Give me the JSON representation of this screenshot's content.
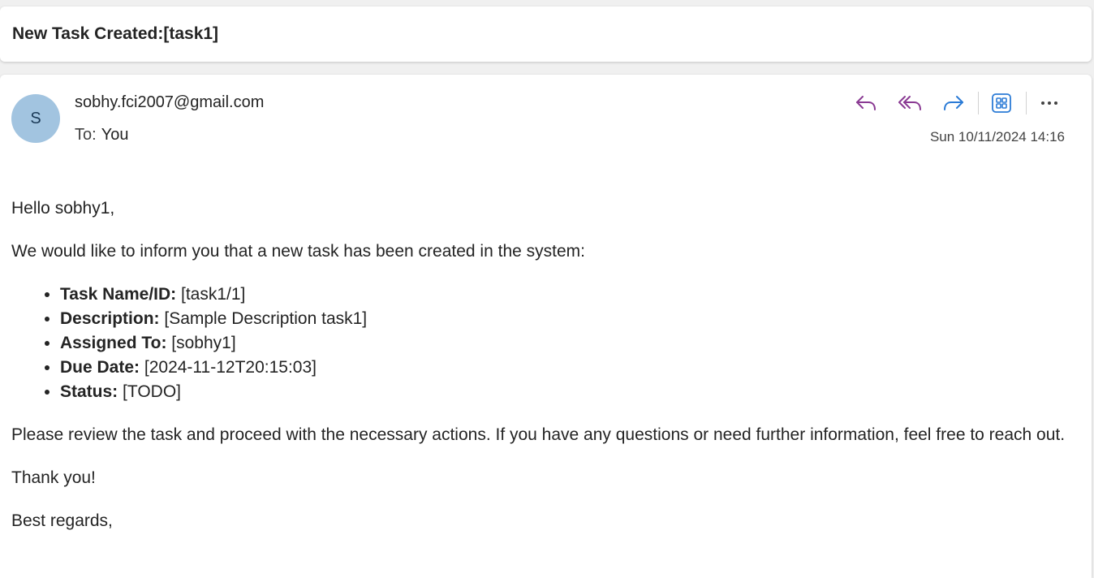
{
  "subject": "New Task Created:[task1]",
  "sender": {
    "avatar_initial": "S",
    "email": "sobhy.fci2007@gmail.com",
    "to_label": "To:",
    "to_value": "You",
    "timestamp": "Sun 10/11/2024 14:16"
  },
  "toolbar": {
    "reply_icon": "reply-icon",
    "reply_all_icon": "reply-all-icon",
    "forward_icon": "forward-icon",
    "apps_icon": "apps-icon",
    "more_icon": "more-icon",
    "accent_purple": "#8a3a93",
    "accent_blue": "#2b7bd6"
  },
  "body": {
    "greeting": "Hello sobhy1,",
    "intro": "We would like to inform you that a new task has been created in the system:",
    "details": [
      {
        "label": "Task Name/ID:",
        "value": "[task1/1]"
      },
      {
        "label": "Description:",
        "value": "[Sample Description task1]"
      },
      {
        "label": "Assigned To:",
        "value": "[sobhy1]"
      },
      {
        "label": "Due Date:",
        "value": "[2024-11-12T20:15:03]"
      },
      {
        "label": "Status:",
        "value": "[TODO]"
      }
    ],
    "review": "Please review the task and proceed with the necessary actions. If you have any questions or need further information, feel free to reach out.",
    "thanks": "Thank you!",
    "closing": "Best regards,"
  }
}
